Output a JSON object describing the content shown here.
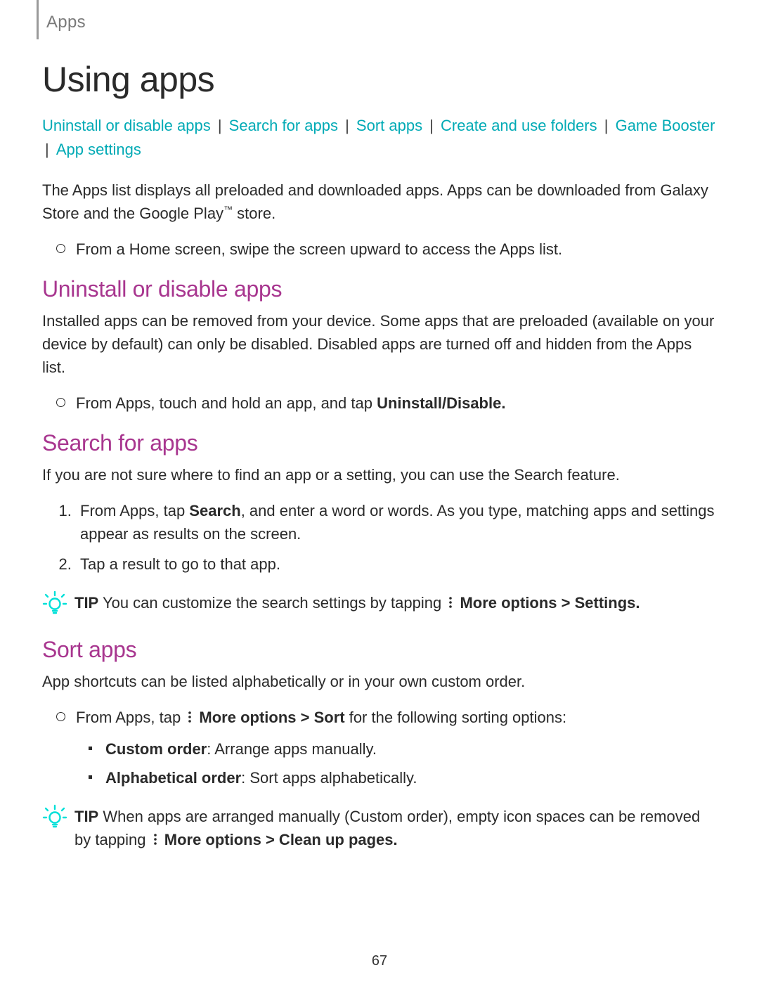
{
  "breadcrumb": "Apps",
  "title": "Using apps",
  "toc": {
    "links": [
      "Uninstall or disable apps",
      "Search for apps",
      "Sort apps",
      "Create and use folders",
      "Game Booster",
      "App settings"
    ]
  },
  "intro": {
    "pre": "The Apps list displays all preloaded and downloaded apps. Apps can be downloaded from Galaxy Store and the Google Play",
    "tm": "™",
    "post": " store."
  },
  "intro_step": "From a Home screen, swipe the screen upward to access the Apps list.",
  "uninstall": {
    "heading": "Uninstall or disable apps",
    "para": "Installed apps can be removed from your device. Some apps that are preloaded (available on your device by default) can only be disabled. Disabled apps are turned off and hidden from the Apps list.",
    "step_pre": "From Apps, touch and hold an app, and tap ",
    "step_bold": "Uninstall/Disable."
  },
  "search": {
    "heading": "Search for apps",
    "para": "If you are not sure where to find an app or a setting, you can use the Search feature.",
    "step1_pre": "From Apps, tap ",
    "step1_bold": "Search",
    "step1_post": ", and enter a word or words. As you type, matching apps and settings appear as results on the screen.",
    "step2": "Tap a result to go to that app.",
    "tip_label": "TIP",
    "tip_pre": "  You can customize the search settings by tapping ",
    "tip_bold": " More options > Settings."
  },
  "sort": {
    "heading": "Sort apps",
    "para": "App shortcuts can be listed alphabetically or in your own custom order.",
    "step_pre": "From Apps, tap ",
    "step_bold": " More options > Sort",
    "step_post": " for the following sorting options:",
    "opt1_bold": "Custom order",
    "opt1_rest": ": Arrange apps manually.",
    "opt2_bold": "Alphabetical order",
    "opt2_rest": ": Sort apps alphabetically.",
    "tip_label": "TIP",
    "tip_pre": "  When apps are arranged manually (Custom order), empty icon spaces can be removed by tapping ",
    "tip_bold": " More options > Clean up pages."
  },
  "page_number": "67",
  "colors": {
    "accent_link": "#00aab5",
    "heading": "#a8368f",
    "tip_icon": "#00e0d8"
  }
}
